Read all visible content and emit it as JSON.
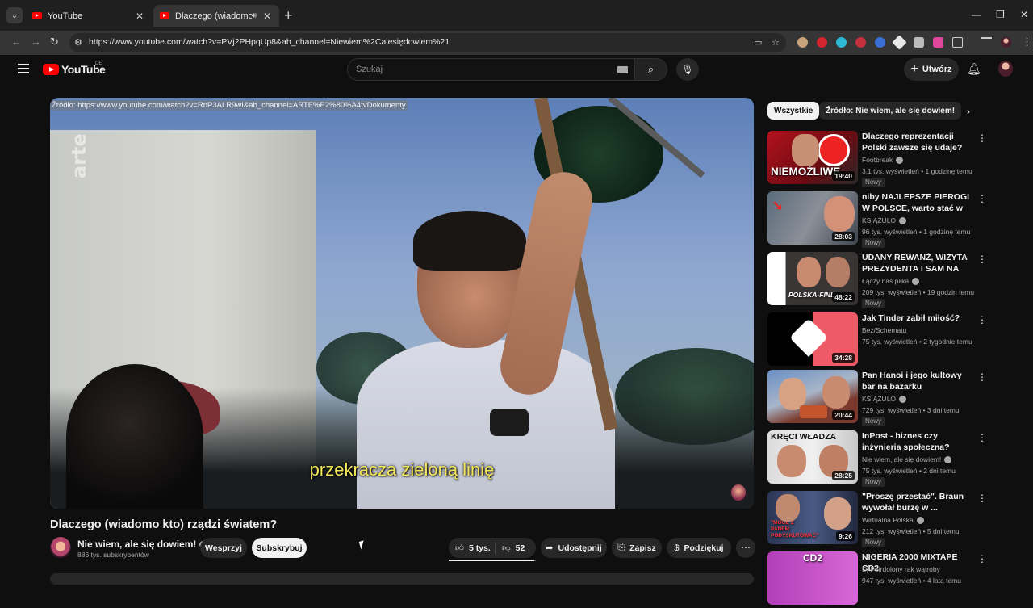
{
  "browser": {
    "tabs": [
      {
        "title": "YouTube",
        "active": false
      },
      {
        "title": "Dlaczego (wiadomo kto) rządzi",
        "active": true
      }
    ],
    "url": "https://www.youtube.com/watch?v=PVj2PHpqUp8&ab_channel=Niewiem%2Calesiędowiem%21"
  },
  "header": {
    "logo_text": "YouTube",
    "logo_region": "DE",
    "search_placeholder": "Szukaj",
    "create_label": "Utwórz"
  },
  "player": {
    "source_label": "Źródło: https://www.youtube.com/watch?v=RnP3ALR9wI&ab_channel=ARTE%E2%80%A4tvDokumenty",
    "subtitle": "przekracza zieloną linię",
    "watermark": "arte"
  },
  "video": {
    "title": "Dlaczego (wiadomo kto) rządzi światem?",
    "channel": "Nie wiem, ale się dowiem!",
    "subscribers": "886 tys. subskrybentów",
    "support_label": "Wesprzyj",
    "subscribe_label": "Subskrybuj",
    "likes": "5 tys.",
    "dislikes": "52",
    "share_label": "Udostępnij",
    "save_label": "Zapisz",
    "thanks_label": "Podziękuj"
  },
  "chips": [
    "Wszystkie",
    "Źródło: Nie wiem, ale się dowiem!"
  ],
  "recommendations": [
    {
      "title": "Dlaczego reprezentacji Polski zawsze się udaje?",
      "channel": "Footbreak",
      "verified": true,
      "meta": "3,1 tys. wyświetleń • 1 godzinę temu",
      "badge": "Nowy",
      "duration": "19:40",
      "thumb_text": "NIEMOŻLIWE"
    },
    {
      "title": "niby NAJLEPSZE PIEROGI W POLSCE, warto stać w kolejce?",
      "channel": "KSIĄŻULO",
      "verified": true,
      "meta": "96 tys. wyświetleń • 1 godzinę temu",
      "badge": "Nowy",
      "duration": "28:03",
      "thumb_text": ""
    },
    {
      "title": "UDANY REWANŻ, WIZYTA PREZYDENTA I SAM NA SAM ...",
      "channel": "Łączy nas piłka",
      "verified": true,
      "meta": "209 tys. wyświetleń • 19 godzin temu",
      "badge": "Nowy",
      "duration": "48:22",
      "thumb_text": "POLSKA-FINL"
    },
    {
      "title": "Jak Tinder zabił miłość?",
      "channel": "Bez/Schematu",
      "verified": false,
      "meta": "75 tys. wyświetleń • 2 tygodnie temu",
      "badge": "",
      "duration": "34:28",
      "thumb_text": ""
    },
    {
      "title": "Pan Hanoi i jego kultowy bar na bazarku",
      "channel": "KSIĄŻULO",
      "verified": true,
      "meta": "729 tys. wyświetleń • 3 dni temu",
      "badge": "Nowy",
      "duration": "20:44",
      "thumb_text": ""
    },
    {
      "title": "InPost - biznes czy inżynieria społeczna?",
      "channel": "Nie wiem, ale się dowiem!",
      "verified": true,
      "meta": "75 tys. wyświetleń • 2 dni temu",
      "badge": "Nowy",
      "duration": "28:25",
      "thumb_text": "KRĘCI WŁADZA"
    },
    {
      "title": "\"Proszę przestać\". Braun wywołał burzę w ...",
      "channel": "Wirtualna Polska",
      "verified": true,
      "meta": "212 tys. wyświetleń • 5 dni temu",
      "badge": "Nowy",
      "duration": "9:26",
      "thumb_text": "\"MOGĘ Z PANEM PODYSKUTOWAĆ\""
    },
    {
      "title": "NIGERIA 2000 MIXTAPE CD2",
      "channel": "Dj Peirdolony rak wątroby",
      "verified": false,
      "meta": "947 tys. wyświetleń • 4 lata temu",
      "badge": "",
      "duration": "",
      "thumb_text": "CD2"
    }
  ],
  "colors": {
    "background": "#0f0f0f",
    "surface": "#272727",
    "subtitle": "#f4e65a",
    "brand": "#ff0000"
  }
}
